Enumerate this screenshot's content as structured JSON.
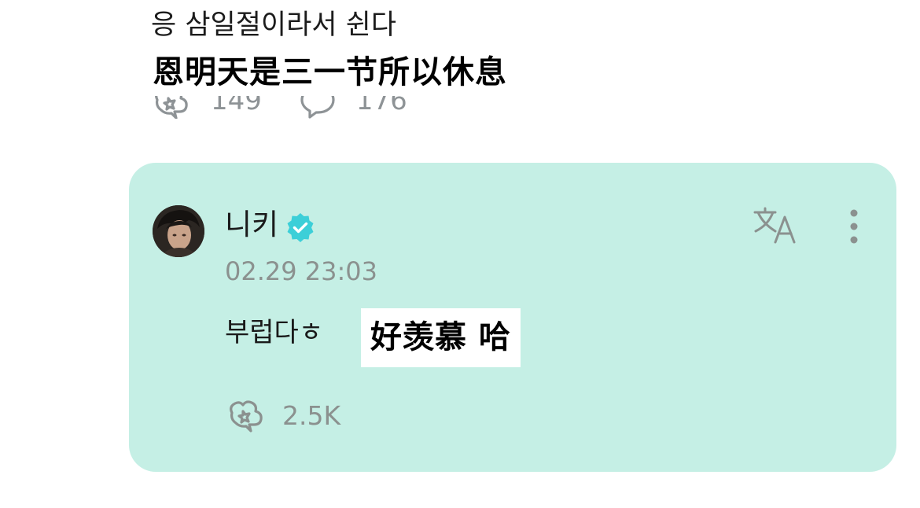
{
  "top_comment": {
    "text": "응 삼일절이라서 쉰다",
    "translation": "恩明天是三一节所以休息",
    "like_count": "149",
    "reply_count": "176",
    "like_icon": "cheer-icon",
    "reply_icon": "comment-bubble-icon"
  },
  "reply": {
    "author": "니키",
    "verified": true,
    "timestamp": "02.29 23:03",
    "text": "부럽다ㅎ",
    "translation": "好羡慕 哈",
    "like_count": "2.5K",
    "icons": [
      "translate-icon",
      "more-options-icon",
      "cheer-icon",
      "verified-badge-icon"
    ]
  },
  "colors": {
    "card_background": "#c5efe5",
    "verified_badge": "#3ccfd8",
    "muted_text": "#8b918f",
    "translation_highlight": "#ffffff"
  }
}
